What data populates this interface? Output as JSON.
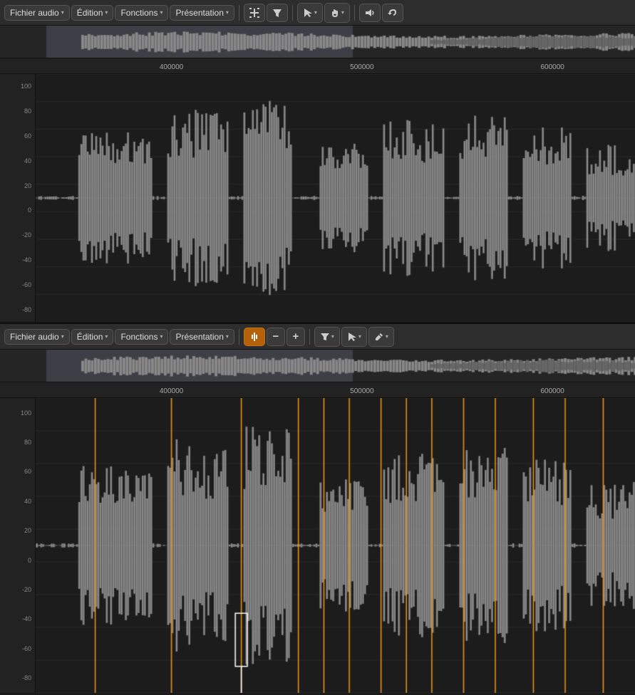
{
  "top_toolbar": {
    "fichier_audio": "Fichier audio",
    "edition": "Édition",
    "fonctions": "Fonctions",
    "presentation": "Présentation"
  },
  "bottom_toolbar": {
    "fichier_audio": "Fichier audio",
    "edition": "Édition",
    "fonctions": "Fonctions",
    "presentation": "Présentation"
  },
  "ruler": {
    "labels": [
      "400000",
      "500000",
      "600000"
    ]
  },
  "y_axis": {
    "labels": [
      "100",
      "80",
      "60",
      "40",
      "20",
      "0",
      "-20",
      "-40",
      "-60",
      "-80"
    ]
  },
  "icons": {
    "arrow_down": "▾",
    "filter": "⋮",
    "cursor": "↖",
    "hand": "✋",
    "speaker": "🔊",
    "undo": "↩",
    "center": "⏎",
    "minus": "−",
    "plus": "+",
    "pencil": "✎"
  }
}
